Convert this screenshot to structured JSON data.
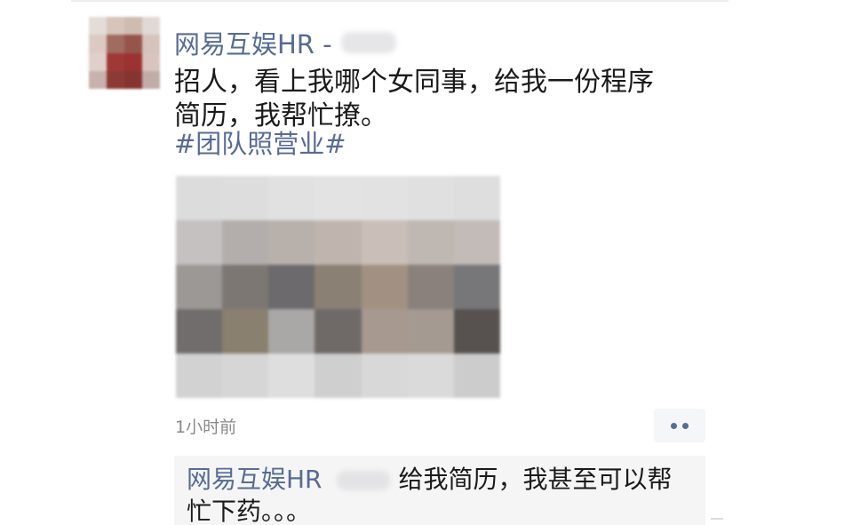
{
  "post": {
    "author": "网易互娱HR -",
    "text_lines": [
      "招人，看上我哪个女同事，给我一份程序",
      "简历，我帮忙撩。"
    ],
    "hashtag": "#团队照营业#",
    "timestamp": "1小时前",
    "photo_pixels": [
      [
        "#dcdcdc",
        "#dddddd",
        "#e1e1e1",
        "#e3e3e3",
        "#e2e2e2",
        "#e0e0e0",
        "#dedede"
      ],
      [
        "#c4c1c0",
        "#b3aeab",
        "#b8b0ab",
        "#bfb5ae",
        "#c9bfb8",
        "#bfb7b2",
        "#c3bbb7"
      ],
      [
        "#9c9896",
        "#7c7773",
        "#6c6a6d",
        "#8b8074",
        "#a29182",
        "#8a817c",
        "#77777a"
      ],
      [
        "#706d6c",
        "#8a806f",
        "#aaa8a6",
        "#6f6a68",
        "#a79990",
        "#a59a92",
        "#57524f"
      ],
      [
        "#d2d2d2",
        "#d6d6d6",
        "#dedede",
        "#cfcfcf",
        "#d8d8d8",
        "#dadada",
        "#cccccc"
      ]
    ]
  },
  "avatar_pixels": [
    [
      "#e4dcd8",
      "#d7c4bb",
      "#cfbcb0",
      "#e1d9d5"
    ],
    [
      "#dcc9c2",
      "#a16b60",
      "#96554c",
      "#d6c3bc"
    ],
    [
      "#e0d0cc",
      "#a03838",
      "#9c3232",
      "#d9c4c0"
    ],
    [
      "#c9b1ad",
      "#8c3a36",
      "#86342f",
      "#c2aca8"
    ]
  ],
  "comment": {
    "author": "网易互娱HR",
    "text_line1": "给我简历，我甚至可以帮",
    "text_line2": "忙下药。。。"
  },
  "colors": {
    "link": "#576b95",
    "text": "#1a1a1a",
    "muted": "#888888",
    "comment_bg": "#f5f5f5"
  }
}
